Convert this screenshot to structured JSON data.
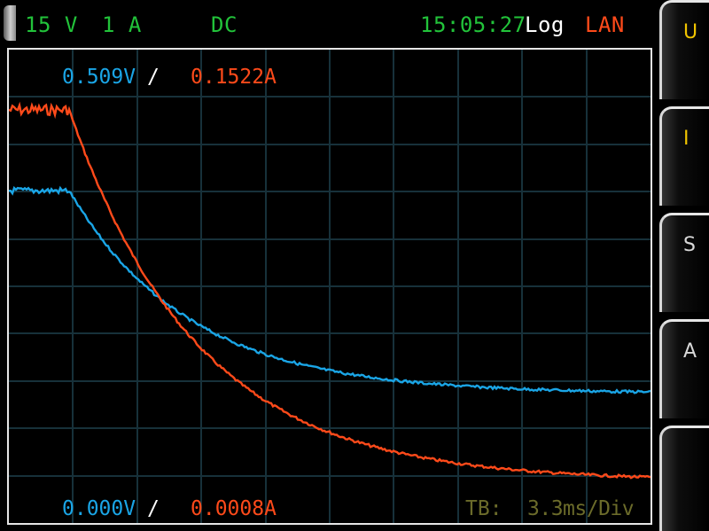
{
  "colors": {
    "background": "#000000",
    "status_green": "#22c33a",
    "white": "#ffffff",
    "lan_orange": "#ff4a1a",
    "voltage_trace": "#1aa5e6",
    "current_trace": "#ff4a1a",
    "grid": "#17313a",
    "frame": "#e6e6e6",
    "timebase_text": "#6b6b2a",
    "softkey_text_active": "#f0c400",
    "softkey_text": "#d8d8d8"
  },
  "status_bar": {
    "voltage_range": "15 V",
    "current_range": "1 A",
    "coupling": "DC",
    "time": "15:05:27",
    "log": "Log",
    "lan": "LAN"
  },
  "plot": {
    "top_voltage": "0.509V",
    "top_current": "0.1522A",
    "bottom_voltage": "0.000V",
    "bottom_current": "0.0008A",
    "separator": "/",
    "timebase_label": "TB:",
    "timebase_value": "3.3ms/Div"
  },
  "softkeys": [
    {
      "label": "U",
      "active": true
    },
    {
      "label": "I",
      "active": false
    },
    {
      "label": "S",
      "active": false
    },
    {
      "label": "A",
      "active": false
    },
    {
      "label": "",
      "active": false
    }
  ]
}
